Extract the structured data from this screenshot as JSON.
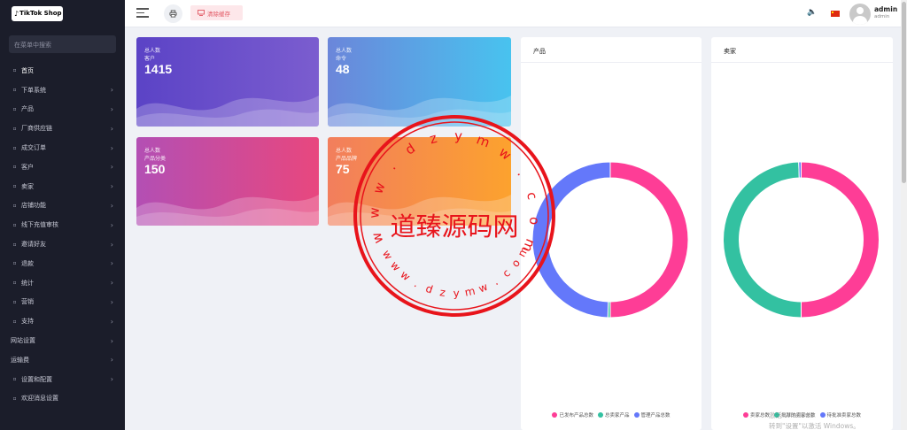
{
  "brand": {
    "logo_text": "TikTok Shop"
  },
  "sidebar": {
    "search_placeholder": "在菜单中搜索",
    "items": [
      {
        "label": "首页",
        "icon": "home-icon",
        "has_children": false
      },
      {
        "label": "下单系统",
        "icon": "funnel-icon",
        "has_children": true
      },
      {
        "label": "产品",
        "icon": "cart-icon",
        "has_children": true
      },
      {
        "label": "厂商供应链",
        "icon": "truck-icon",
        "has_children": true
      },
      {
        "label": "成交订单",
        "icon": "list-icon",
        "has_children": true
      },
      {
        "label": "客户",
        "icon": "users-icon",
        "has_children": true
      },
      {
        "label": "卖家",
        "icon": "user-icon",
        "has_children": true
      },
      {
        "label": "店铺功能",
        "icon": "tools-icon",
        "has_children": true
      },
      {
        "label": "线下充值审核",
        "icon": "upload-icon",
        "has_children": true
      },
      {
        "label": "邀请好友",
        "icon": "link-icon",
        "has_children": true
      },
      {
        "label": "退款",
        "icon": "return-icon",
        "has_children": true
      },
      {
        "label": "统计",
        "icon": "chart-icon",
        "has_children": true
      },
      {
        "label": "营销",
        "icon": "bullhorn-icon",
        "has_children": true
      },
      {
        "label": "支持",
        "icon": "support-icon",
        "has_children": true
      },
      {
        "label": "网站设置",
        "icon": "",
        "has_children": true
      },
      {
        "label": "运输费",
        "icon": "",
        "has_children": true
      },
      {
        "label": "设置和配置",
        "icon": "gear-icon",
        "has_children": true
      },
      {
        "label": "欢迎消息设置",
        "icon": "gear-icon",
        "has_children": false
      }
    ]
  },
  "header": {
    "clear_cache_label": "清除缓存",
    "user_name": "admin",
    "user_role": "admin"
  },
  "stats": [
    {
      "line1": "总人数",
      "line2": "客户",
      "value": "1415"
    },
    {
      "line1": "总人数",
      "line2": "命令",
      "value": "48"
    },
    {
      "line1": "总人数",
      "line2": "产品分类",
      "value": "150"
    },
    {
      "line1": "总人数",
      "line2": "产品品牌",
      "value": "75"
    }
  ],
  "panels": {
    "products": {
      "title": "产品",
      "legend": [
        "已发布产品总数",
        "总卖家产品",
        "管理产品总数"
      ]
    },
    "sellers": {
      "title": "卖家",
      "legend": [
        "卖家总数",
        "批准的卖家总数",
        "待批准卖家总数"
      ]
    }
  },
  "chart_data": [
    {
      "type": "pie",
      "title": "产品",
      "categories": [
        "已发布产品总数",
        "总卖家产品",
        "管理产品总数"
      ],
      "values": [
        50,
        0.5,
        49.5
      ],
      "colors": [
        "#fe3d96",
        "#33c1a1",
        "#6478fa"
      ],
      "legend_position": "bottom"
    },
    {
      "type": "pie",
      "title": "卖家",
      "categories": [
        "卖家总数",
        "批准的卖家总数",
        "待批准卖家总数"
      ],
      "values": [
        50,
        49.5,
        0.5
      ],
      "colors": [
        "#fe3d96",
        "#33c1a1",
        "#6478fa"
      ],
      "legend_position": "bottom"
    }
  ],
  "stamp": {
    "main_text": "道臻源码网",
    "url_top": "www.dzymw.com",
    "url_bottom": "www.dzymw.com",
    "color": "#e8141b"
  },
  "os_watermark": {
    "line1": "激活 Windows",
    "line2": "转到\"设置\"以激活 Windows。"
  }
}
